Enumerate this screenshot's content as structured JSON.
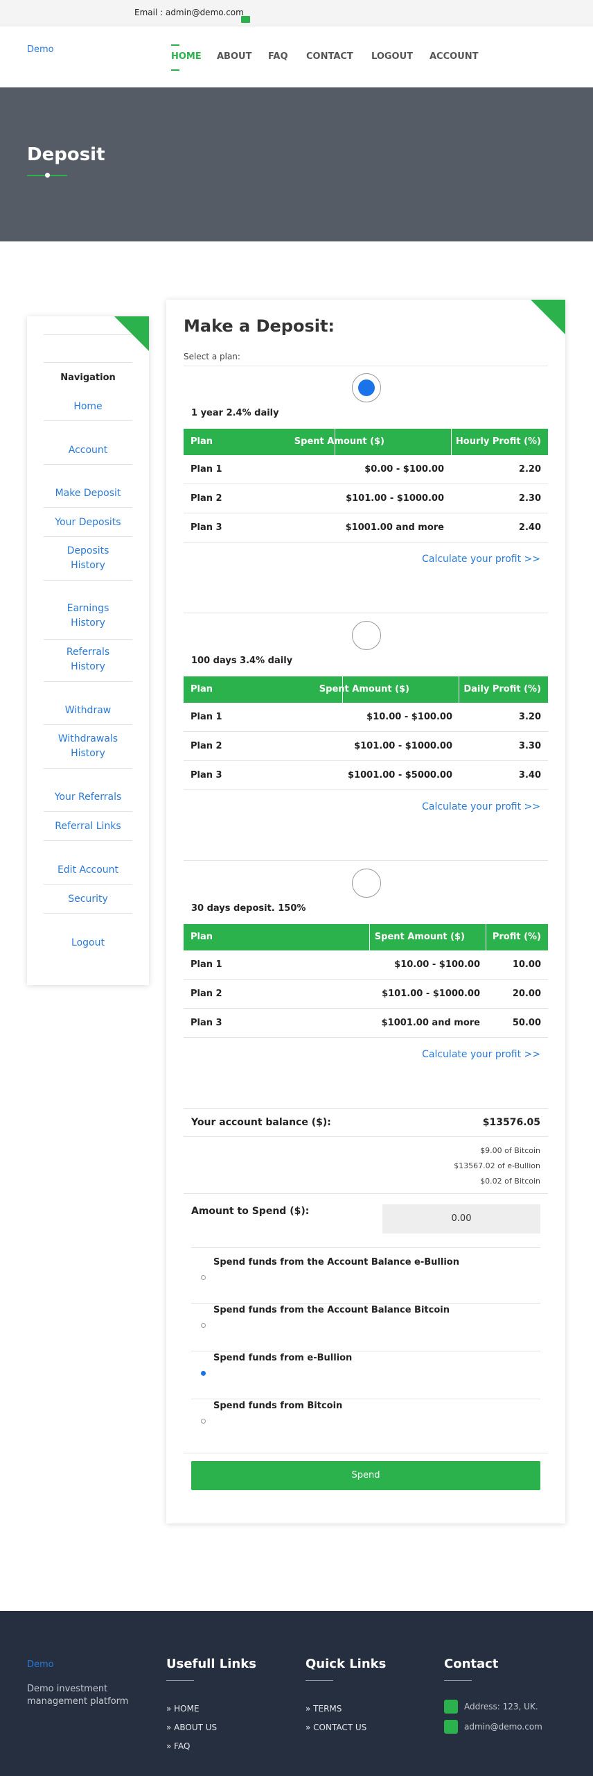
{
  "topbar": {
    "email": "Email : admin@demo.com"
  },
  "nav": {
    "logo": "Demo",
    "items": [
      "HOME",
      "ABOUT",
      "FAQ",
      "CONTACT",
      "LOGOUT",
      "ACCOUNT"
    ]
  },
  "hero": {
    "title": "Deposit"
  },
  "sidebar": {
    "title": "Navigation",
    "items": [
      "Home",
      "Account",
      "Make Deposit",
      "Your Deposits",
      "Deposits History",
      "Earnings History",
      "Referrals History",
      "Withdraw",
      "Withdrawals History",
      "Your Referrals",
      "Referral Links",
      "Edit Account",
      "Security",
      "Logout"
    ]
  },
  "main": {
    "title": "Make a Deposit:",
    "select_label": "Select a plan:",
    "plans": [
      {
        "title": "1 year 2.4% daily",
        "selected": true,
        "headers": [
          "Plan",
          "Spent Amount ($)",
          "Hourly Profit (%)"
        ],
        "rows": [
          [
            "Plan 1",
            "$0.00 - $100.00",
            "2.20"
          ],
          [
            "Plan 2",
            "$101.00 - $1000.00",
            "2.30"
          ],
          [
            "Plan 3",
            "$1001.00 and more",
            "2.40"
          ]
        ],
        "calc": "Calculate your profit >>"
      },
      {
        "title": "100 days 3.4% daily",
        "selected": false,
        "headers": [
          "Plan",
          "Spent Amount ($)",
          "Daily Profit (%)"
        ],
        "rows": [
          [
            "Plan 1",
            "$10.00 - $100.00",
            "3.20"
          ],
          [
            "Plan 2",
            "$101.00 - $1000.00",
            "3.30"
          ],
          [
            "Plan 3",
            "$1001.00 - $5000.00",
            "3.40"
          ]
        ],
        "calc": "Calculate your profit >>"
      },
      {
        "title": "30 days deposit. 150%",
        "selected": false,
        "headers": [
          "Plan",
          "Spent Amount ($)",
          "Profit (%)"
        ],
        "rows": [
          [
            "Plan 1",
            "$10.00 - $100.00",
            "10.00"
          ],
          [
            "Plan 2",
            "$101.00 - $1000.00",
            "20.00"
          ],
          [
            "Plan 3",
            "$1001.00 and more",
            "50.00"
          ]
        ],
        "calc": "Calculate your profit >>"
      }
    ],
    "balance_label": "Your account balance ($):",
    "balance_value": "$13576.05",
    "balance_breakdown": [
      "$9.00 of Bitcoin",
      "$13567.02 of e-Bullion",
      "$0.02 of Bitcoin"
    ],
    "amount_label": "Amount to Spend ($):",
    "amount_value": "0.00",
    "options": [
      {
        "label": "Spend funds from the Account Balance e-Bullion",
        "selected": false
      },
      {
        "label": "Spend funds from the Account Balance Bitcoin",
        "selected": false
      },
      {
        "label": "Spend funds from e-Bullion",
        "selected": true
      },
      {
        "label": "Spend funds from Bitcoin",
        "selected": false
      }
    ],
    "spend_button": "Spend"
  },
  "footer": {
    "logo": "Demo",
    "description": "Demo investment management platform",
    "useful_title": "Usefull Links",
    "useful_links": [
      "» HOME",
      "» ABOUT US",
      "» FAQ"
    ],
    "quick_title": "Quick Links",
    "quick_links": [
      "» TERMS",
      "» CONTACT US"
    ],
    "contact_title": "Contact",
    "address": "Address: 123, UK.",
    "email": "admin@demo.com"
  },
  "colors": {
    "accent": "#2bb24c",
    "link": "#2a7ad8",
    "hero": "#555c66",
    "footer": "#262f3f"
  }
}
